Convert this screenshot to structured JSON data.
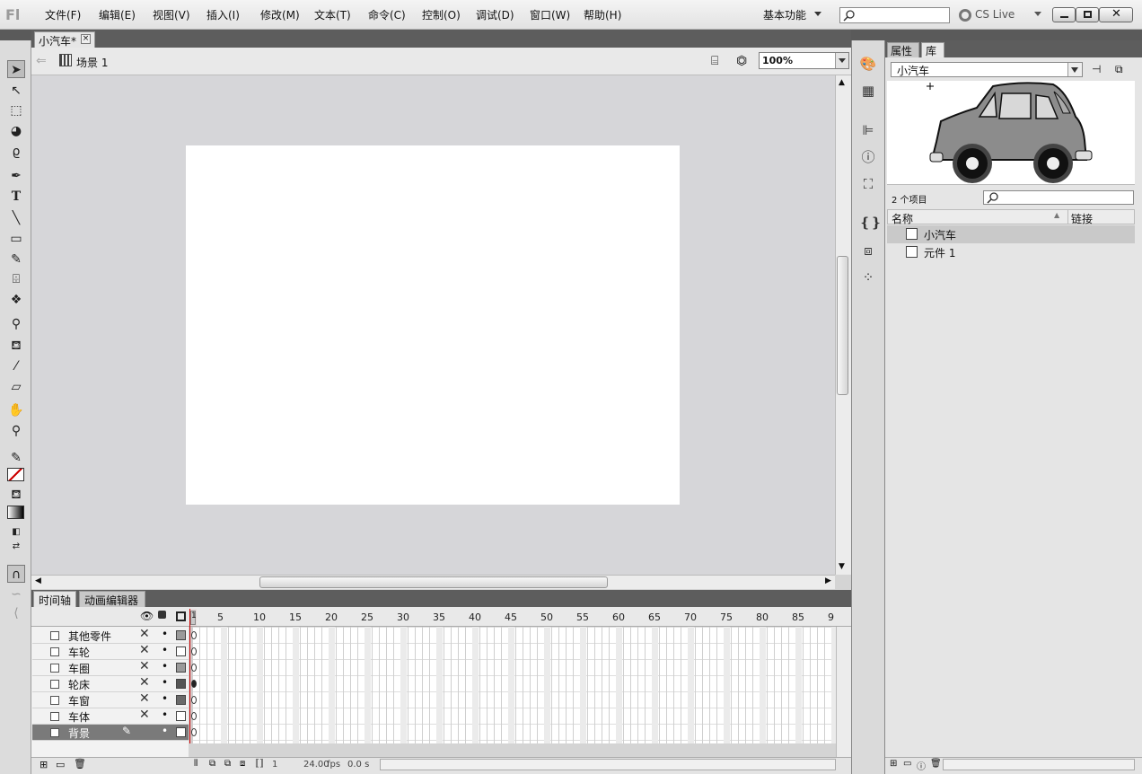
{
  "app": {
    "logo": "Fl"
  },
  "menu": [
    {
      "label": "文件(F)"
    },
    {
      "label": "编辑(E)"
    },
    {
      "label": "视图(V)"
    },
    {
      "label": "插入(I)"
    },
    {
      "label": "修改(M)"
    },
    {
      "label": "文本(T)"
    },
    {
      "label": "命令(C)"
    },
    {
      "label": "控制(O)"
    },
    {
      "label": "调试(D)"
    },
    {
      "label": "窗口(W)"
    },
    {
      "label": "帮助(H)"
    }
  ],
  "workspace": {
    "label": "基本功能"
  },
  "cslive": {
    "label": "CS Live"
  },
  "document": {
    "tab_label": "小汽车*",
    "close": "×",
    "scene_label": "场景 1",
    "zoom": "100%"
  },
  "timeline": {
    "tabs": [
      "时间轴",
      "动画编辑器"
    ],
    "frame_numbers": [
      "5",
      "10",
      "15",
      "20",
      "25",
      "30",
      "35",
      "40",
      "45",
      "50",
      "55",
      "60",
      "65",
      "70",
      "75",
      "80",
      "85",
      "9"
    ],
    "playhead_label": "1",
    "layers": [
      {
        "name": "其他零件",
        "swatch": "#9a9a9a"
      },
      {
        "name": "车轮",
        "swatch": "#ffffff"
      },
      {
        "name": "车圈",
        "swatch": "#9a9a9a"
      },
      {
        "name": "轮床",
        "swatch": "#555555"
      },
      {
        "name": "车窗",
        "swatch": "#6a6a6a"
      },
      {
        "name": "车体",
        "swatch": "#ffffff"
      },
      {
        "name": "背景",
        "swatch": "#ffffff",
        "selected": true
      }
    ],
    "footer": {
      "frame": "1",
      "fps": "24.00",
      "fps_unit": "fps",
      "time": "0.0 s"
    }
  },
  "library": {
    "tabs": [
      "属性",
      "库"
    ],
    "document": "小汽车",
    "item_count": "2 个项目",
    "columns": {
      "name": "名称",
      "linkage": "链接"
    },
    "items": [
      {
        "name": "小汽车",
        "selected": true
      },
      {
        "name": "元件 1"
      }
    ]
  },
  "colors": {
    "selection": "#7a7a7a",
    "panel_header": "#5d5d5d",
    "stage": "#ffffff"
  }
}
